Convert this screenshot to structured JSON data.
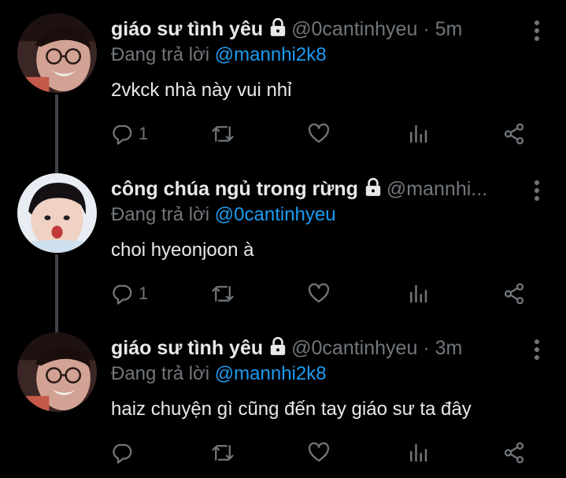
{
  "colors": {
    "background": "#000000",
    "text": "#e7e9ea",
    "muted": "#71767b",
    "link": "#1d9bf0"
  },
  "tweets": [
    {
      "name": "giáo sư tình yêu",
      "handle": "@0cantinhyeu",
      "separator": "·",
      "time": "5m",
      "reply_prefix": "Đang trả lời",
      "reply_to": "@mannhi2k8",
      "text": "2vkck nhà này vui nhỉ",
      "reply_count": "1",
      "icons": [
        "lock-icon",
        "reply-icon",
        "retweet-icon",
        "like-icon",
        "analytics-icon",
        "share-icon",
        "more-icon"
      ]
    },
    {
      "name": "công chúa ngủ trong rừng",
      "handle": "@mannhi...",
      "separator": "",
      "time": "",
      "reply_prefix": "Đang trả lời",
      "reply_to": "@0cantinhyeu",
      "text": "choi hyeonjoon à",
      "reply_count": "1",
      "icons": [
        "lock-icon",
        "reply-icon",
        "retweet-icon",
        "like-icon",
        "analytics-icon",
        "share-icon",
        "more-icon"
      ]
    },
    {
      "name": "giáo sư tình yêu",
      "handle": "@0cantinhyeu",
      "separator": "·",
      "time": "3m",
      "reply_prefix": "Đang trả lời",
      "reply_to": "@mannhi2k8",
      "text": "haiz chuyện gì cũng đến tay giáo sư ta đây",
      "reply_count": "",
      "icons": [
        "lock-icon",
        "reply-icon",
        "retweet-icon",
        "like-icon",
        "analytics-icon",
        "share-icon",
        "more-icon"
      ]
    }
  ]
}
